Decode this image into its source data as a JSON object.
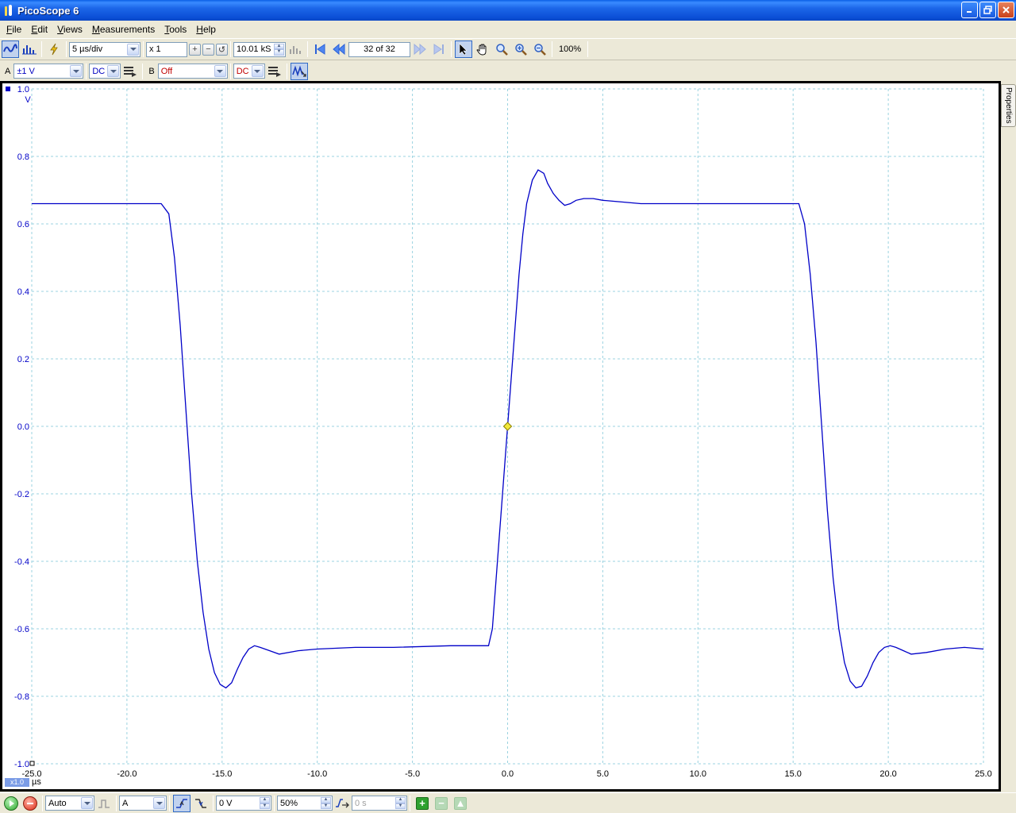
{
  "window": {
    "title": "PicoScope 6"
  },
  "menu": [
    {
      "label": "File",
      "key": "F",
      "rest": "ile"
    },
    {
      "label": "Edit",
      "key": "E",
      "rest": "dit"
    },
    {
      "label": "Views",
      "key": "V",
      "rest": "iews"
    },
    {
      "label": "Measurements",
      "key": "M",
      "rest": "easurements"
    },
    {
      "label": "Tools",
      "key": "T",
      "rest": "ools"
    },
    {
      "label": "Help",
      "key": "H",
      "rest": "elp"
    }
  ],
  "toolbar": {
    "timebase": "5 µs/div",
    "zoom_factor": "x 1",
    "samples": "10.01 kS",
    "buffer_position": "32 of 32",
    "zoom_percent": "100%"
  },
  "channels": {
    "a": {
      "label": "A",
      "range": "±1 V",
      "coupling": "DC"
    },
    "b": {
      "label": "B",
      "range": "Off",
      "coupling": "DC"
    }
  },
  "trigger_bar": {
    "mode": "Auto",
    "source": "A",
    "level": "0 V",
    "pre_trigger": "50%",
    "delay": "0 s"
  },
  "properties_tab": "Properties",
  "axis": {
    "x_unit_badge": "x1.0",
    "x_unit": "µs",
    "y_unit": "V"
  },
  "colors": {
    "trace": "#0000c8",
    "grid": "#9bd3e0",
    "trigger_marker": "#f2e83a"
  },
  "chart_data": {
    "type": "line",
    "xlim": [
      -25.0,
      25.0
    ],
    "ylim": [
      -1.0,
      1.0
    ],
    "xticks": [
      -25.0,
      -20.0,
      -15.0,
      -10.0,
      -5.0,
      0.0,
      5.0,
      10.0,
      15.0,
      20.0,
      25.0
    ],
    "xtick_labels": [
      "-25.0",
      "-20.0",
      "-15.0",
      "-10.0",
      "-5.0",
      "0.0",
      "5.0",
      "10.0",
      "15.0",
      "20.0",
      "25.0"
    ],
    "yticks": [
      1.0,
      0.8,
      0.6,
      0.4,
      0.2,
      0.0,
      -0.2,
      -0.4,
      -0.6,
      -0.8,
      -1.0
    ],
    "ytick_labels": [
      "1.0",
      "0.8",
      "0.6",
      "0.4",
      "0.2",
      "0.0",
      "-0.2",
      "-0.4",
      "-0.6",
      "-0.8",
      "-1.0"
    ],
    "grid": true,
    "trigger_point": [
      0.0,
      0.0
    ],
    "series": [
      {
        "x": [
          -25.0,
          -18.2,
          -17.8,
          -17.5,
          -17.2,
          -16.9,
          -16.6,
          -16.3,
          -16.0,
          -15.7,
          -15.4,
          -15.1,
          -14.8,
          -14.5,
          -14.2,
          -13.9,
          -13.6,
          -13.3,
          -13.0,
          -12.5,
          -12.0,
          -11.0,
          -10.0,
          -8.0,
          -6.0,
          -3.0,
          -1.0,
          -0.8,
          -0.6,
          -0.4,
          -0.2,
          0.0,
          0.2,
          0.4,
          0.6,
          0.8,
          1.0,
          1.3,
          1.6,
          1.9,
          2.1,
          2.4,
          2.7,
          3.0,
          3.3,
          3.6,
          4.0,
          4.5,
          5.0,
          6.0,
          7.0,
          9.0,
          12.0,
          15.3,
          15.6,
          15.9,
          16.2,
          16.5,
          16.8,
          17.1,
          17.4,
          17.7,
          18.0,
          18.3,
          18.6,
          18.9,
          19.2,
          19.5,
          19.8,
          20.1,
          20.4,
          20.8,
          21.2,
          22.0,
          23.0,
          24.0,
          25.0
        ],
        "y": [
          0.66,
          0.66,
          0.63,
          0.5,
          0.3,
          0.05,
          -0.2,
          -0.4,
          -0.55,
          -0.66,
          -0.73,
          -0.765,
          -0.775,
          -0.76,
          -0.72,
          -0.685,
          -0.66,
          -0.65,
          -0.655,
          -0.665,
          -0.675,
          -0.665,
          -0.66,
          -0.655,
          -0.655,
          -0.65,
          -0.65,
          -0.6,
          -0.45,
          -0.3,
          -0.15,
          0.0,
          0.15,
          0.3,
          0.45,
          0.57,
          0.66,
          0.73,
          0.76,
          0.75,
          0.72,
          0.69,
          0.67,
          0.655,
          0.66,
          0.67,
          0.675,
          0.675,
          0.67,
          0.665,
          0.66,
          0.66,
          0.66,
          0.66,
          0.6,
          0.45,
          0.25,
          0.0,
          -0.25,
          -0.45,
          -0.6,
          -0.7,
          -0.755,
          -0.775,
          -0.77,
          -0.74,
          -0.7,
          -0.67,
          -0.655,
          -0.65,
          -0.655,
          -0.665,
          -0.675,
          -0.67,
          -0.66,
          -0.655,
          -0.66
        ]
      }
    ]
  }
}
